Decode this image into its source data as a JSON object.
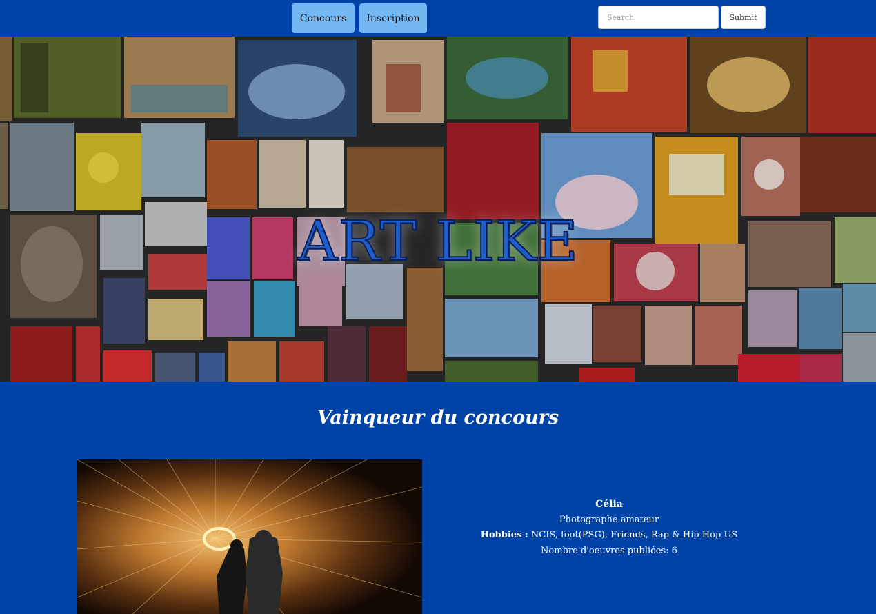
{
  "nav": {
    "items": [
      {
        "label": "Concours"
      },
      {
        "label": "Inscription"
      }
    ],
    "search": {
      "placeholder": "Search",
      "value": ""
    },
    "submit_label": "Submit"
  },
  "hero": {
    "title": "ART LIKE"
  },
  "winner": {
    "section_title": "Vainqueur du concours",
    "name": "Célia",
    "occupation": "Photographe amateur",
    "hobbies_label": "Hobbies :",
    "hobbies": "NCIS, foot(PSG), Friends, Rap & Hip Hop US",
    "works_count": "Nombre d'oeuvres publiées: 6"
  },
  "colors": {
    "background": "#0043a6",
    "nav_button": "#72b6f2",
    "title_blue": "#1f5ecb"
  }
}
